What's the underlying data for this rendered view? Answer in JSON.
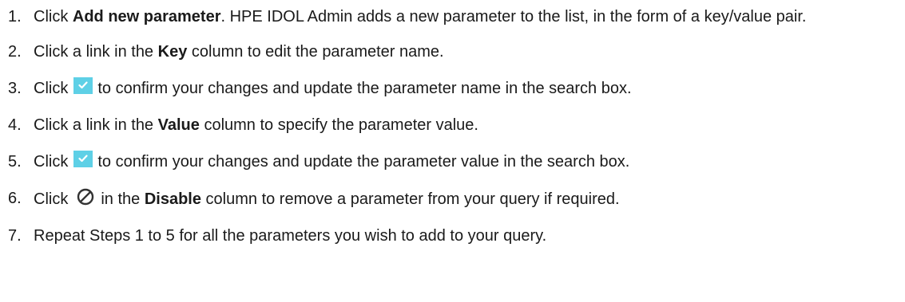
{
  "steps": [
    {
      "number": "1",
      "parts": [
        "Click ",
        "Add new parameter",
        ". HPE IDOL Admin adds a new parameter to the list, in the form of a key/value pair."
      ]
    },
    {
      "number": "2",
      "parts": [
        "Click a link in the ",
        "Key",
        " column to edit the parameter name."
      ]
    },
    {
      "number": "3",
      "parts": [
        "Click",
        "to confirm your changes and update the parameter name in the search box."
      ],
      "icon": "confirm-check-icon"
    },
    {
      "number": "4",
      "parts": [
        "Click a link in the ",
        "Value",
        " column to specify the parameter value."
      ]
    },
    {
      "number": "5",
      "parts": [
        "Click",
        "to confirm your changes and update the parameter value in the search box."
      ],
      "icon": "confirm-check-icon"
    },
    {
      "number": "6",
      "parts": [
        "Click",
        "in the ",
        "Disable",
        " column to remove a parameter from your query if required."
      ],
      "icon": "disable-circle-slash-icon"
    },
    {
      "number": "7",
      "parts": [
        "Repeat Steps 1 to 5 for all the parameters you wish to add to your query."
      ]
    }
  ],
  "colors": {
    "text": "#1a1a1a",
    "confirm_icon_bg": "#5ed0e6",
    "confirm_icon_check": "#ffffff",
    "disable_icon": "#333333"
  }
}
